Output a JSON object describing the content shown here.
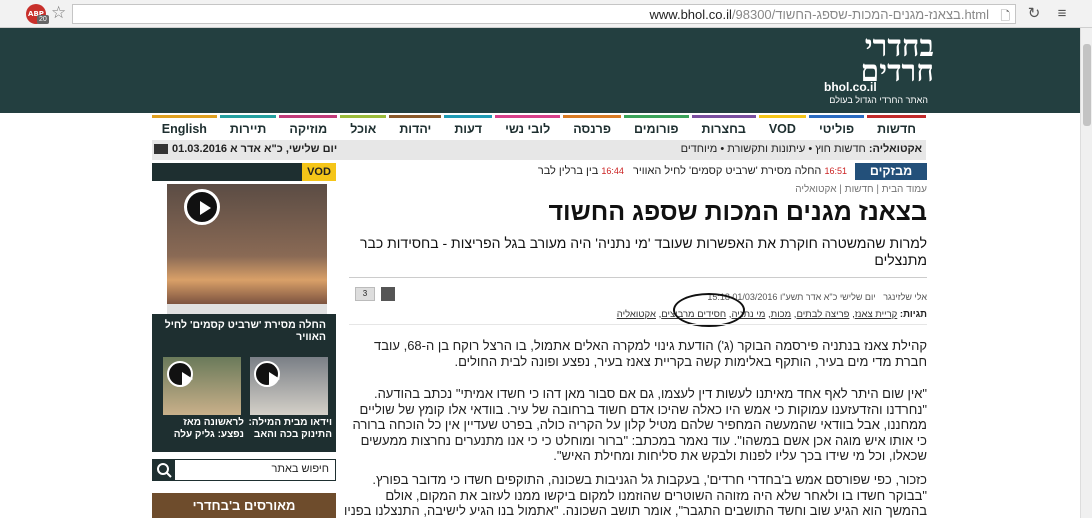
{
  "browser": {
    "url_domain": "www.bhol.co.il",
    "url_path": "/98300/",
    "url_slug": "בצאנז-מגנים-המכות-שספג-החשוד.html",
    "adblock_label": "ABP",
    "adblock_badge": "20"
  },
  "header": {
    "logo_text": "בחדרי חרדים",
    "logo_domain": "bhol.co.il",
    "logo_tagline": "האתר החרדי הגדול בעולם"
  },
  "nav": {
    "items": [
      {
        "label": "חדשות",
        "color": "#c22b2b"
      },
      {
        "label": "פוליטי",
        "color": "#2b6cc2"
      },
      {
        "label": "VOD",
        "color": "#f5c518"
      },
      {
        "label": "בחצרות",
        "color": "#7a4fa0"
      },
      {
        "label": "פורומים",
        "color": "#3aa35a"
      },
      {
        "label": "פרנסה",
        "color": "#d97b24"
      },
      {
        "label": "לובי נשי",
        "color": "#d8408a"
      },
      {
        "label": "דעות",
        "color": "#1f9bb5"
      },
      {
        "label": "יהדות",
        "color": "#8b5a2b"
      },
      {
        "label": "אוכל",
        "color": "#9bbb3a"
      },
      {
        "label": "מוזיקה",
        "color": "#c23b7a"
      },
      {
        "label": "תיירות",
        "color": "#24a0a0"
      },
      {
        "label": "English",
        "color": "#e0a020"
      }
    ]
  },
  "ticker": {
    "label": "אקטואליה:",
    "text": "חדשות חוץ • עיתונות ותקשורת • מיוחדים",
    "date": "יום שלישי, כ\"א אדר א 01.03.2016"
  },
  "breaking": {
    "label": "מבזקים",
    "items": [
      {
        "time": "16:51",
        "text": "החלה מסירת 'שרביט קסמים' לחיל האוויר"
      },
      {
        "time": "16:44",
        "text": "בין ברלין לבר"
      }
    ]
  },
  "sidebar": {
    "vod_label": "VOD",
    "main_video_caption": "החלה מסירת 'שרביט קסמים' לחיל האוויר",
    "thumb1_caption": "וידאו מבית המילה: התינוק בכה והאב",
    "thumb2_caption": "לראשונה מאז נפצע: גליק עלה",
    "search_placeholder": "חיפוש באתר",
    "forum_title": "מאורסים ב'בחדרי"
  },
  "article": {
    "breadcrumbs": [
      "עמוד הבית",
      "חדשות",
      "אקטואליה"
    ],
    "title": "בצאנז מגנים המכות שספג החשוד",
    "subtitle": "למרות שהמשטרה חוקרת את האפשרות שעובד 'מי נתניה' היה מעורב בגל הפריצות - בחסידות כבר מתנצלים",
    "byline_author": "אלי שלזינגר",
    "byline_date": "יום שלישי כ\"א אדר תשע\"ו 01/03/2016 15:18",
    "comment_count": "3",
    "tags_label": "תגיות:",
    "tags": [
      "קריית צאנז",
      "פריצה לבתים",
      "מכות",
      "מי נתניה",
      "חסידים מרביצים",
      "אקטואליה"
    ],
    "paragraphs": [
      "קהילת צאנז בנתניה פירסמה הבוקר (ג') הודעת גינוי למקרה האלים אתמול, בו הרצל רוקח בן ה-68, עובד חברת מדי מים בעיר, הותקף באלימות קשה בקריית צאנז בעיר, נפצע ופונה לבית החולים.",
      "\"אין שום היתר לאף אחד מאיתנו לעשות דין לעצמו, גם אם סבור מאן דהו כי חשדו אמיתי\" נכתב בהודעה. \"נחרדנו והזדעזענו עמוקות כי אמש היו כאלה שהיכו אדם חשוד ברחובה של עיר. בוודאי אלו קומץ של שוליים ממחננו, אבל בוודאי שהמעשה המחפיר שלהם מטיל קלון על הקריה כולה, בפרט שעדיין אין כל הוכחה ברורה כי אותו איש מוגה אכן אשם במשהו\". עוד נאמר במכתב: \"ברור ומוחלט כי כי אנו מתנערים נחרצות ממעשים שכאלו, וכל מי שידו בכך עליו לפנות ולבקש את סליחות ומחילת האיש\".",
      "כזכור, כפי שפורסם אמש ב'בחדרי חרדים', בעקבות גל הגניבות בשכונה, התוקפים חשדו כי מדובר בפורץ. \"בבוקר חשדו בו ולאחר שלא היה מזוהה השוטרים שהוזמנו למקום ביקשו ממנו לעזוב את המקום, אולם בהמשך הוא הגיע שוב וחשד התושבים התגבר\", אומר תושב השכונה. \"אתמול בנו הגיע לישיבה, התנצלנו בפניו ואנו מתכוונים להמשיך"
    ]
  }
}
